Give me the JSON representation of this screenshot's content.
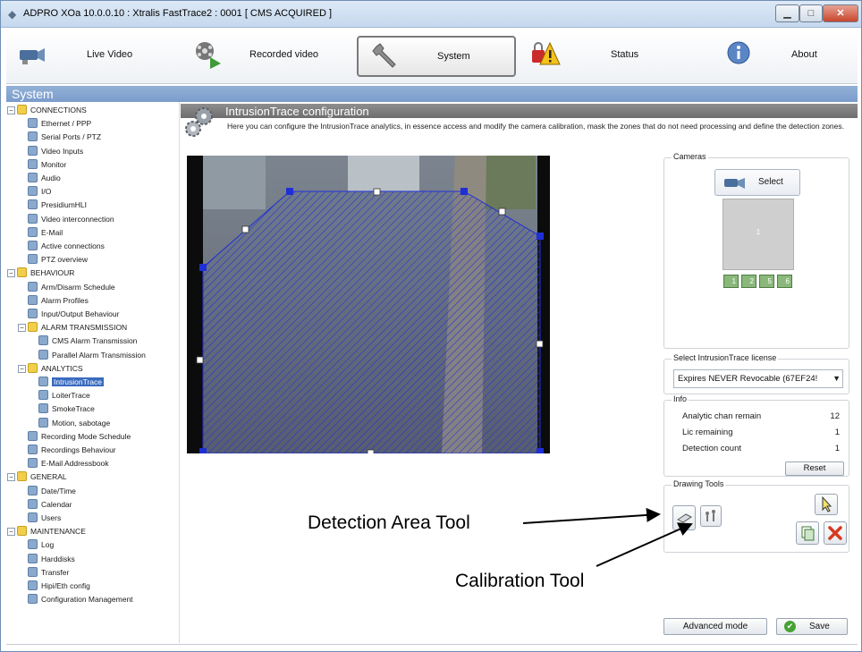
{
  "window": {
    "title": "ADPRO XOa  10.0.0.10  :  Xtralis FastTrace2  :  0001  [ CMS ACQUIRED ]",
    "min_glyph": "▁",
    "max_glyph": "□",
    "close_glyph": "✕"
  },
  "toolbar": {
    "items": [
      {
        "label": "Live Video",
        "icon": "camera-icon"
      },
      {
        "label": "Recorded video",
        "icon": "film-reel-icon"
      },
      {
        "label": "System",
        "icon": "wrench-icon"
      },
      {
        "label": "Status",
        "icon": "warning-lock-icon"
      },
      {
        "label": "About",
        "icon": "info-icon"
      }
    ],
    "active": "System"
  },
  "system_header": "System",
  "sidebar": {
    "items": [
      {
        "label": "CONNECTIONS",
        "type": "folder"
      },
      {
        "label": "Ethernet / PPP",
        "type": "leaf"
      },
      {
        "label": "Serial Ports / PTZ",
        "type": "leaf"
      },
      {
        "label": "Video Inputs",
        "type": "leaf"
      },
      {
        "label": "Monitor",
        "type": "leaf"
      },
      {
        "label": "Audio",
        "type": "leaf"
      },
      {
        "label": "I/O",
        "type": "leaf"
      },
      {
        "label": "PresidiumHLI",
        "type": "leaf"
      },
      {
        "label": "Video interconnection",
        "type": "leaf"
      },
      {
        "label": "E-Mail",
        "type": "leaf"
      },
      {
        "label": "Active connections",
        "type": "leaf"
      },
      {
        "label": "PTZ overview",
        "type": "leaf"
      },
      {
        "label": "BEHAVIOUR",
        "type": "folder"
      },
      {
        "label": "Arm/Disarm Schedule",
        "type": "leaf"
      },
      {
        "label": "Alarm Profiles",
        "type": "leaf"
      },
      {
        "label": "Input/Output Behaviour",
        "type": "leaf"
      },
      {
        "label": "ALARM TRANSMISSION",
        "type": "folder"
      },
      {
        "label": "CMS Alarm Transmission",
        "type": "leaf"
      },
      {
        "label": "Parallel Alarm Transmission",
        "type": "leaf"
      },
      {
        "label": "ANALYTICS",
        "type": "folder"
      },
      {
        "label": "IntrusionTrace",
        "type": "leaf"
      },
      {
        "label": "LoiterTrace",
        "type": "leaf"
      },
      {
        "label": "SmokeTrace",
        "type": "leaf"
      },
      {
        "label": "Motion, sabotage",
        "type": "leaf"
      },
      {
        "label": "Recording Mode Schedule",
        "type": "leaf"
      },
      {
        "label": "Recordings Behaviour",
        "type": "leaf"
      },
      {
        "label": "E-Mail Addressbook",
        "type": "leaf"
      },
      {
        "label": "GENERAL",
        "type": "folder"
      },
      {
        "label": "Date/Time",
        "type": "leaf"
      },
      {
        "label": "Calendar",
        "type": "leaf"
      },
      {
        "label": "Users",
        "type": "leaf"
      },
      {
        "label": "MAINTENANCE",
        "type": "folder"
      },
      {
        "label": "Log",
        "type": "leaf"
      },
      {
        "label": "Harddisks",
        "type": "leaf"
      },
      {
        "label": "Transfer",
        "type": "leaf"
      },
      {
        "label": "Hipi/Eth config",
        "type": "leaf"
      },
      {
        "label": "Configuration Management",
        "type": "leaf"
      }
    ],
    "selected": "IntrusionTrace"
  },
  "config": {
    "title": "IntrusionTrace configuration",
    "description": "Here you can configure the IntrusionTrace analytics, in essence access and modify the camera calibration, mask the zones that do not need processing and define the detection zones."
  },
  "cameras": {
    "title": "Cameras",
    "select_label": "Select",
    "thumb_number": "1",
    "chips": [
      "1",
      "2",
      "5",
      "6"
    ]
  },
  "license": {
    "title": "Select IntrusionTrace license",
    "value": "Expires NEVER Revocable  (67EF24!",
    "arrow": "▼"
  },
  "info": {
    "title": "Info",
    "rows": [
      {
        "label": "Analytic chan remain",
        "value": "12"
      },
      {
        "label": "Lic remaining",
        "value": "1"
      },
      {
        "label": "Detection count",
        "value": "1"
      }
    ],
    "reset_label": "Reset"
  },
  "drawing_tools": {
    "title": "Drawing Tools"
  },
  "buttons": {
    "advanced": "Advanced mode",
    "save": "Save",
    "save_glyph": "✔"
  },
  "annotations": {
    "detection": "Detection Area Tool",
    "calibration": "Calibration Tool"
  },
  "colors": {
    "polygon": "#1f2fd6",
    "selection": "#3a6bbf",
    "header_blue": "#7b9ccc"
  }
}
